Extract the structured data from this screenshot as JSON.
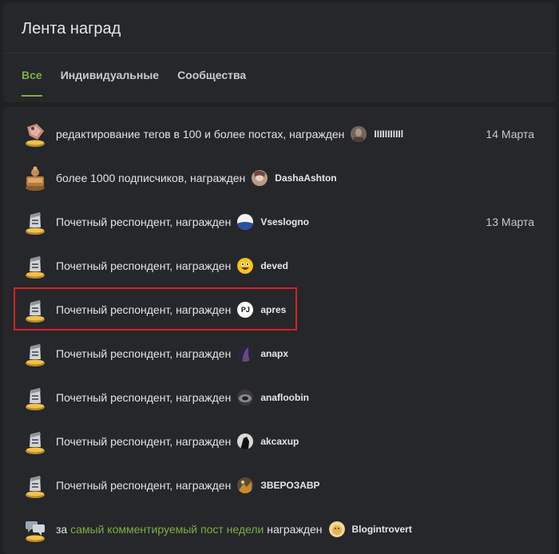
{
  "header": {
    "title": "Лента наград"
  },
  "tabs": [
    {
      "label": "Все",
      "active": true
    },
    {
      "label": "Индивидуальные",
      "active": false
    },
    {
      "label": "Сообщества",
      "active": false
    }
  ],
  "awards": [
    {
      "icon": "tag-award-icon",
      "text": "редактирование тегов в 100 и более постах, награжден",
      "user": "IIIIIIIIIIl",
      "date": "14 Марта"
    },
    {
      "icon": "1000-subscribers-award-icon",
      "text": "более 1000 подписчиков, награжден",
      "user": "DashaAshton",
      "date": ""
    },
    {
      "icon": "honorary-respondent-award-icon",
      "text": "Почетный респондент, награжден",
      "user": "Vseslogno",
      "date": "13 Марта"
    },
    {
      "icon": "honorary-respondent-award-icon",
      "text": "Почетный респондент, награжден",
      "user": "deved",
      "date": ""
    },
    {
      "icon": "honorary-respondent-award-icon",
      "text": "Почетный респондент, награжден",
      "user": "apres",
      "date": ""
    },
    {
      "icon": "honorary-respondent-award-icon",
      "text": "Почетный респондент, награжден",
      "user": "anapx",
      "date": ""
    },
    {
      "icon": "honorary-respondent-award-icon",
      "text": "Почетный респондент, награжден",
      "user": "anafloobin",
      "date": ""
    },
    {
      "icon": "honorary-respondent-award-icon",
      "text": "Почетный респондент, награжден",
      "user": "akcaxup",
      "date": ""
    },
    {
      "icon": "honorary-respondent-award-icon",
      "text": "Почетный респондент, награжден",
      "user": "ЗВЕРОЗАВР",
      "date": ""
    },
    {
      "icon": "comment-award-icon",
      "text_prefix": "за",
      "link": "самый комментируемый пост недели",
      "text_suffix": "награжден",
      "user": "Blogintrovert",
      "date": ""
    }
  ],
  "avatar_glyphs": {
    "apres": "PJ"
  },
  "colors": {
    "accent": "#7caf45",
    "highlight": "#d2232a",
    "background": "#1e2022",
    "card": "#25272a"
  }
}
